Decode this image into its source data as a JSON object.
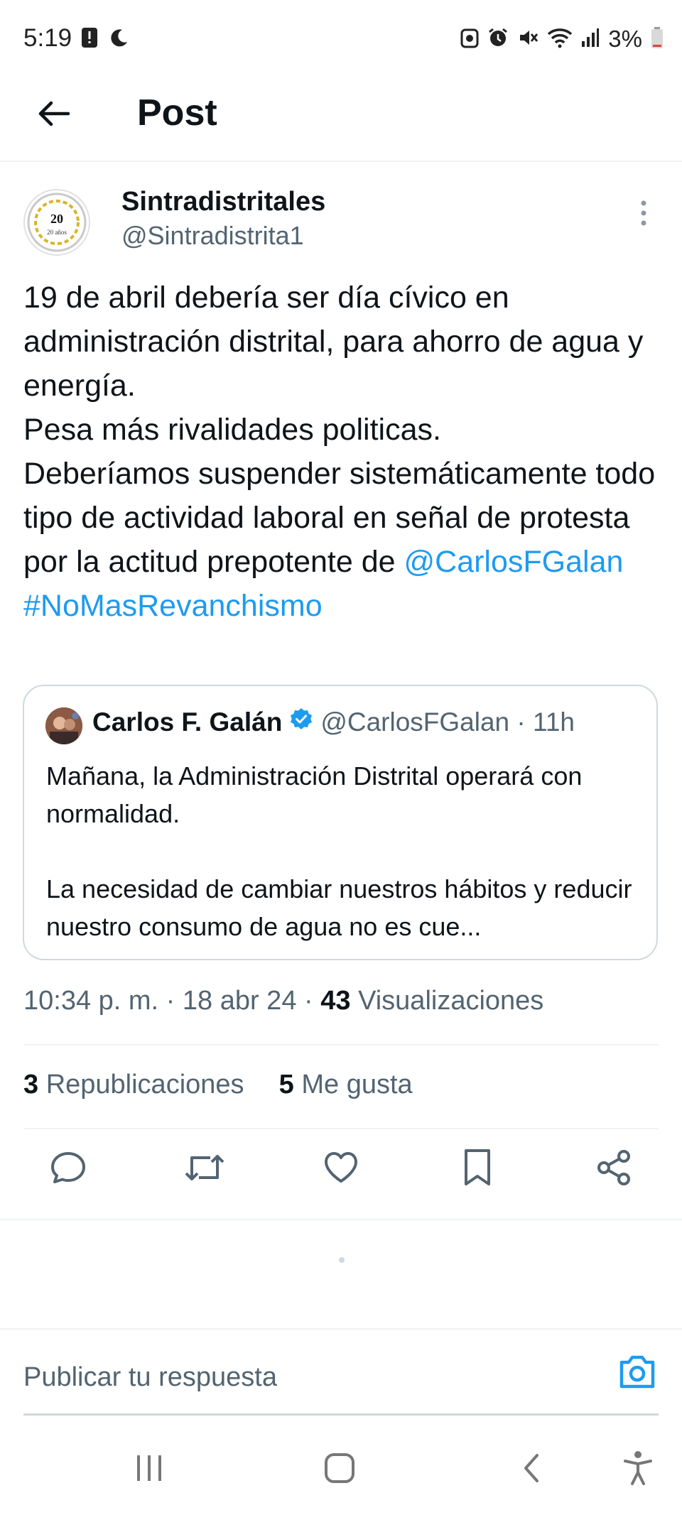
{
  "status_bar": {
    "time": "5:19",
    "battery_percent": "3%",
    "left_icons": [
      "alert-icon",
      "moon-icon"
    ],
    "right_icons": [
      "battery-saver-icon",
      "alarm-icon",
      "mute-icon",
      "wifi-icon",
      "signal-icon",
      "battery-icon"
    ]
  },
  "header": {
    "title": "Post",
    "back_icon": "arrow-left-icon"
  },
  "post": {
    "author_name": "Sintradistritales",
    "author_handle": "@Sintradistrita1",
    "avatar_text": "20 años",
    "text_lines": [
      "19 de abril debería ser día cívico en administración distrital, para ahorro de agua y energía.",
      "Pesa más rivalidades politicas.",
      "Deberíamos suspender sistemáticamente todo tipo de actividad laboral en señal de protesta por la actitud prepotente de "
    ],
    "mention": "@CarlosFGalan",
    "hashtag": "#NoMasRevanchismo",
    "timestamp": "10:34 p. m. · 18 abr 24 · ",
    "views_count": "43",
    "views_label": " Visualizaciones",
    "reposts_count": "3",
    "reposts_label": " Republicaciones",
    "likes_count": "5",
    "likes_label": " Me gusta"
  },
  "quote": {
    "name": "Carlos F. Galán",
    "handle_time": "@CarlosFGalan · 11h",
    "verified_color": "#1d9bf0",
    "paragraph1": "Mañana, la Administración Distrital operará con normalidad.",
    "paragraph2": "La necesidad de cambiar nuestros hábitos y reducir nuestro consumo de agua no es cue..."
  },
  "actions": [
    "reply-icon",
    "repost-icon",
    "like-icon",
    "bookmark-icon",
    "share-icon"
  ],
  "reply_bar": {
    "placeholder": "Publicar tu respuesta",
    "camera_icon": "camera-icon"
  },
  "colors": {
    "accent": "#1d9bf0",
    "text": "#0f1419",
    "secondary": "#536471"
  }
}
